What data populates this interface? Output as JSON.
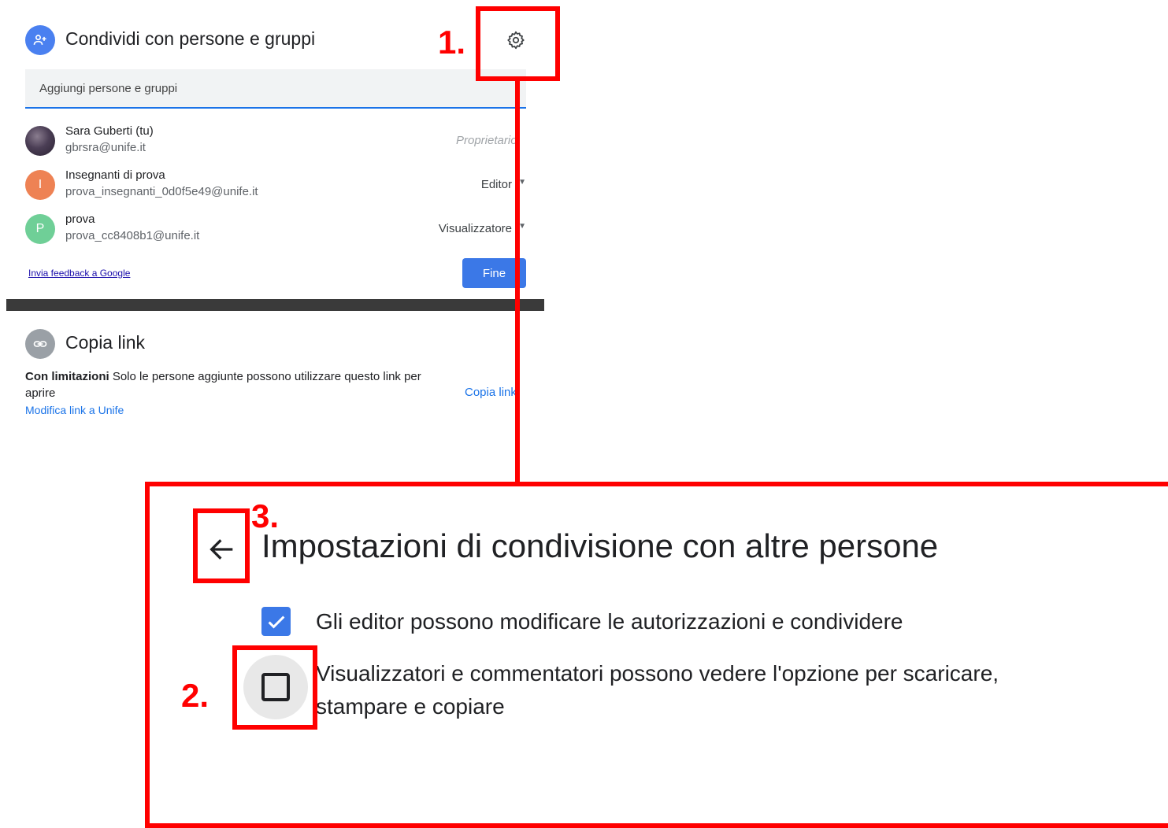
{
  "share_dialog": {
    "title": "Condividi con persone e gruppi",
    "add_placeholder": "Aggiungi persone e gruppi",
    "people": [
      {
        "name": "Sara Guberti (tu)",
        "email": "gbrsra@unife.it",
        "role": "Proprietario",
        "avatar": "photo"
      },
      {
        "name": "Insegnanti di prova",
        "email": "prova_insegnanti_0d0f5e49@unife.it",
        "role": "Editor",
        "avatar": "I"
      },
      {
        "name": "prova",
        "email": "prova_cc8408b1@unife.it",
        "role": "Visualizzatore",
        "avatar": "P"
      }
    ],
    "feedback_link": "Invia feedback a Google",
    "done_button": "Fine"
  },
  "copy_link": {
    "title": "Copia link",
    "restriction_bold": "Con limitazioni",
    "restriction_text": " Solo le persone aggiunte possono utilizzare questo link per aprire",
    "copy_button": "Copia link",
    "modify_link": "Modifica link a Unife"
  },
  "settings": {
    "title": "Impostazioni di condivisione con altre persone",
    "option_editors": "Gli editor possono modificare le autorizzazioni e condividere",
    "option_editors_checked": true,
    "option_viewers": "Visualizzatori e commentatori possono vedere l'opzione per scaricare, stampare e copiare",
    "option_viewers_checked": false
  },
  "annotations": {
    "step1": "1.",
    "step2": "2.",
    "step3": "3."
  },
  "colors": {
    "annotation": "#ff0000",
    "accent": "#1a73e8",
    "button": "#3b78e7"
  }
}
